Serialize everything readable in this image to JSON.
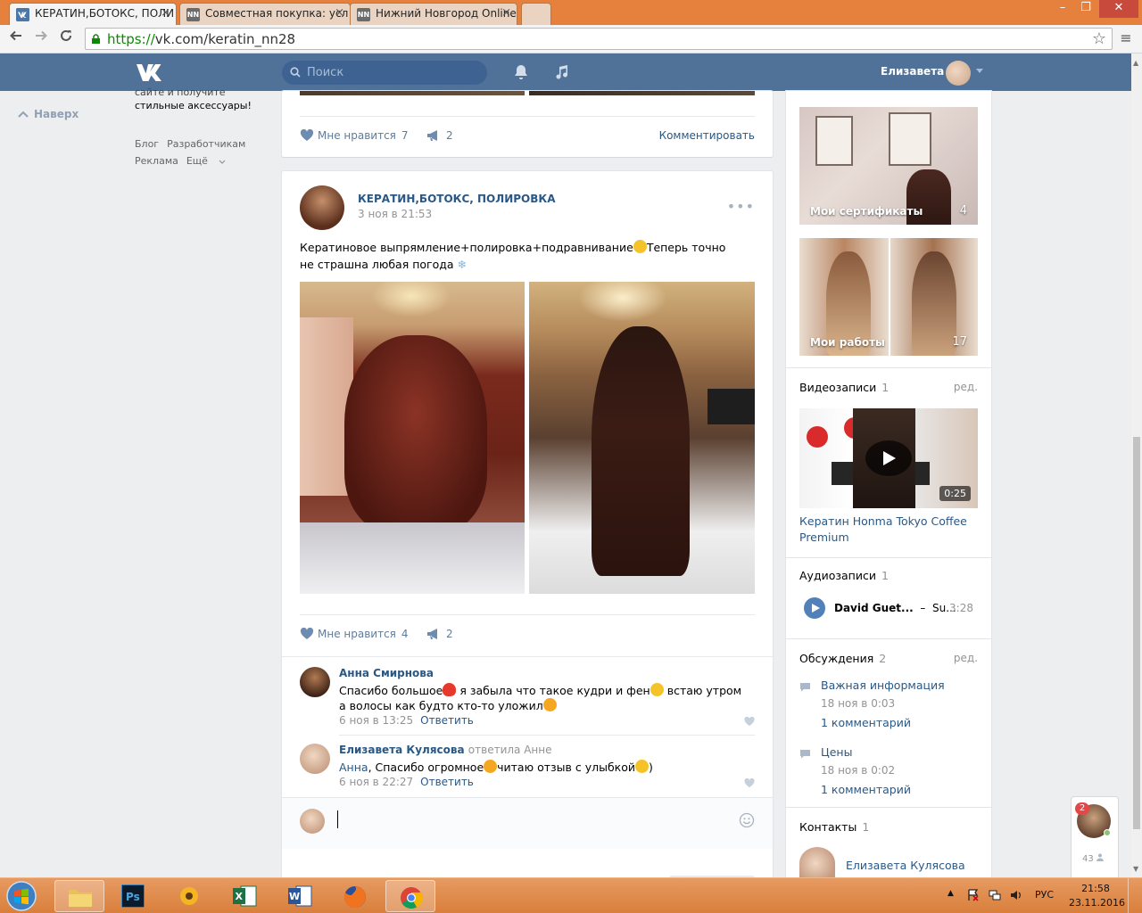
{
  "browser": {
    "tabs": [
      {
        "title": "КЕРАТИН,БОТОКС, ПОЛИ",
        "favicon": "vk-favicon",
        "active": true
      },
      {
        "title": "Совместная покупка: усл",
        "favicon": "nn-favicon",
        "active": false
      },
      {
        "title": "Нижний Новгород Online",
        "favicon": "nn-favicon",
        "active": false
      }
    ],
    "tab_close": "×",
    "favicon_nn": "NN",
    "url_scheme": "https://",
    "url_rest": "vk.com/keratin_nn28",
    "window_buttons": {
      "minimize": "–",
      "maximize": "❐",
      "close": "✕"
    }
  },
  "vk_header": {
    "search_placeholder": "Поиск",
    "user_name": "Елизавета"
  },
  "left_column": {
    "up_label": "Наверх",
    "promo_line1": "сайте и получите",
    "promo_line2": "стильные аксессуары!",
    "links": [
      "Блог",
      "Разработчикам",
      "Реклама",
      "Ещё"
    ]
  },
  "post_top": {
    "like_label": "Мне нравится",
    "like_count": "7",
    "share_count": "2",
    "comment_label": "Комментировать"
  },
  "post_main": {
    "author": "КЕРАТИН,БОТОКС, ПОЛИРОВКА",
    "date": "3 ноя в 21:53",
    "text_part1": "Кератиновое выпрямление+полировка+подравнивание",
    "text_part2": "Теперь точно не страшна любая погода",
    "like_label": "Мне нравится",
    "like_count": "4",
    "share_count": "2",
    "comments": [
      {
        "author": "Анна Смирнова",
        "text_part1": "Спасибо большое",
        "text_part2": " я забыла что такое кудри и фен",
        "text_part3": " встаю утром а волосы как будто кто-то уложил",
        "date": "6 ноя в 13:25",
        "reply_label": "Ответить"
      },
      {
        "author": "Елизавета Кулясова",
        "replied_to": "ответила Анне",
        "addressee": "Анна",
        "text_part1": ", Спасибо огромное",
        "text_part2": "читаю отзыв с улыбкой",
        "text_part3": ")",
        "date": "6 ноя в 22:27",
        "reply_label": "Ответить"
      }
    ]
  },
  "sidebar": {
    "albums": [
      {
        "label": "Мои сертификаты",
        "count": "4"
      },
      {
        "label": "Мои работы",
        "count": "17"
      }
    ],
    "videos": {
      "title": "Видеозаписи",
      "count": "1",
      "edit": "ред.",
      "duration": "0:25",
      "video_title": "Кератин Honma Tokyo Coffee Premium"
    },
    "audio": {
      "title": "Аудиозаписи",
      "count": "1",
      "artist": "David Guet...",
      "dash": "–",
      "track": "Su...",
      "duration": "3:28"
    },
    "discussions": {
      "title": "Обсуждения",
      "count": "2",
      "edit": "ред.",
      "topics": [
        {
          "title": "Важная информация",
          "date": "18 ноя в 0:03",
          "comments": "1 комментарий"
        },
        {
          "title": "Цены",
          "date": "18 ноя в 0:02",
          "comments": "1 комментарий"
        }
      ]
    },
    "contacts": {
      "title": "Контакты",
      "count": "1",
      "name": "Елизавета Кулясова"
    }
  },
  "chat_widget": {
    "badge": "2",
    "online_count": "43"
  },
  "taskbar": {
    "language": "РУС",
    "time": "21:58",
    "date": "23.11.2016"
  }
}
